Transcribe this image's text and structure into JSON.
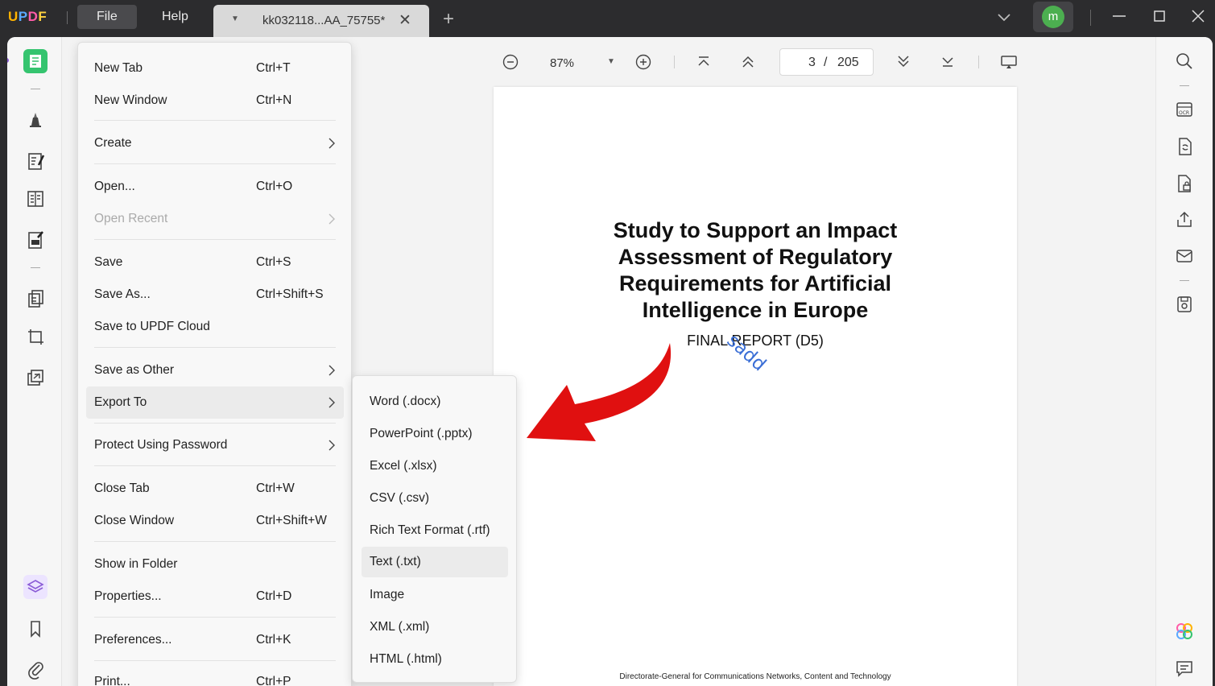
{
  "app": {
    "logo_text": "UPDF",
    "menus": {
      "file": "File",
      "help": "Help"
    },
    "tab": {
      "title": "kk032118...AA_75755*"
    },
    "avatar_initial": "m"
  },
  "toolbar": {
    "zoom": "87%",
    "page_current": "3",
    "page_separator": "/",
    "page_total": "205"
  },
  "document": {
    "title_lines": [
      "Study to Support an Impact",
      "Assessment of Regulatory",
      "Requirements for Artificial",
      "Intelligence in Europe"
    ],
    "subtitle": "FINAL REPORT (D5)",
    "annotation": "sadd",
    "footer": "Directorate-General for Communications Networks, Content and Technology"
  },
  "file_menu": {
    "items": [
      {
        "label": "New Tab",
        "shortcut": "Ctrl+T"
      },
      {
        "label": "New Window",
        "shortcut": "Ctrl+N"
      },
      {
        "label": "Create",
        "shortcut": ""
      },
      {
        "label": "Open...",
        "shortcut": "Ctrl+O"
      },
      {
        "label": "Open Recent",
        "shortcut": ""
      },
      {
        "label": "Save",
        "shortcut": "Ctrl+S"
      },
      {
        "label": "Save As...",
        "shortcut": "Ctrl+Shift+S"
      },
      {
        "label": "Save to UPDF Cloud",
        "shortcut": ""
      },
      {
        "label": "Save as Other",
        "shortcut": ""
      },
      {
        "label": "Export To",
        "shortcut": ""
      },
      {
        "label": "Protect Using Password",
        "shortcut": ""
      },
      {
        "label": "Close Tab",
        "shortcut": "Ctrl+W"
      },
      {
        "label": "Close Window",
        "shortcut": "Ctrl+Shift+W"
      },
      {
        "label": "Show in Folder",
        "shortcut": ""
      },
      {
        "label": "Properties...",
        "shortcut": "Ctrl+D"
      },
      {
        "label": "Preferences...",
        "shortcut": "Ctrl+K"
      },
      {
        "label": "Print...",
        "shortcut": "Ctrl+P"
      }
    ]
  },
  "export_menu": {
    "items": [
      "Word (.docx)",
      "PowerPoint (.pptx)",
      "Excel (.xlsx)",
      "CSV (.csv)",
      "Rich Text Format (.rtf)",
      "Text (.txt)",
      "Image",
      "XML (.xml)",
      "HTML (.html)"
    ]
  },
  "colors": {
    "accent_green": "#35c46f",
    "arrow_red": "#e01010",
    "annotation_blue": "#3b6fd6",
    "titlebar": "#2c2c2e"
  }
}
